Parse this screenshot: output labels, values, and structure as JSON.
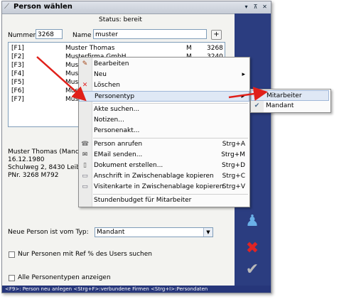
{
  "window": {
    "title": "Person wählen",
    "status": "Status: bereit",
    "title_buttons": [
      "▾",
      "⊼",
      "✕"
    ]
  },
  "search": {
    "nummer_label": "Nummer",
    "nummer_value": "3268",
    "name_label": "Name",
    "name_value": "muster",
    "plus_label": "+"
  },
  "list": {
    "rows": [
      {
        "key": "[F1]",
        "name": "Muster Thomas",
        "type": "M",
        "num": "3268"
      },
      {
        "key": "[F2]",
        "name": "Musterfirma GmbH",
        "type": "M",
        "num": "3240"
      },
      {
        "key": "[F3]",
        "name": "Mus",
        "type": "",
        "num": ""
      },
      {
        "key": "[F4]",
        "name": "Mus",
        "type": "",
        "num": ""
      },
      {
        "key": "[F5]",
        "name": "Mus",
        "type": "",
        "num": ""
      },
      {
        "key": "[F6]",
        "name": "Mus",
        "type": "",
        "num": ""
      },
      {
        "key": "[F7]",
        "name": "Mus",
        "type": "",
        "num": ""
      }
    ]
  },
  "details": {
    "line1": "Muster Thomas (Manc",
    "line2": "16.12.1980",
    "line3": "Schulweg 2, 8430 Leib",
    "line4": "PNr. 3268 M792"
  },
  "form": {
    "type_label": "Neue Person ist vom Typ:",
    "type_value": "Mandant",
    "only_ref_label": "Nur Personen mit Ref % des Users suchen",
    "all_types_label": "Alle Personentypen anzeigen"
  },
  "status_bar": "<F9>: Person neu anlegen <Strg+F>:verbundene Firmen <Strg+I>:Persondaten",
  "context_menu": {
    "items": [
      {
        "label": "Bearbeiten",
        "shortcut": "",
        "icon": "edit-icon"
      },
      {
        "label": "Neu",
        "shortcut": "",
        "icon": ""
      },
      {
        "label": "Löschen",
        "shortcut": "",
        "icon": "delete-icon"
      },
      {
        "label": "Personentyp",
        "shortcut": "",
        "icon": ""
      },
      {
        "label": "Akte suchen...",
        "shortcut": "",
        "icon": ""
      },
      {
        "label": "Notizen...",
        "shortcut": "",
        "icon": ""
      },
      {
        "label": "Personenakt...",
        "shortcut": "",
        "icon": ""
      },
      {
        "label": "Person anrufen",
        "shortcut": "Strg+A",
        "icon": "phone-icon"
      },
      {
        "label": "EMail senden...",
        "shortcut": "Strg+M",
        "icon": "mail-icon"
      },
      {
        "label": "Dokument erstellen...",
        "shortcut": "Strg+D",
        "icon": "document-icon"
      },
      {
        "label": "Anschrift in Zwischenablage kopieren",
        "shortcut": "Strg+C",
        "icon": "card-icon"
      },
      {
        "label": "Visitenkarte in Zwischenablage kopieren",
        "shortcut": "Strg+V",
        "icon": "card-icon"
      },
      {
        "label": "Stundenbudget für Mitarbeiter",
        "shortcut": "",
        "icon": ""
      }
    ],
    "submenu_arrow": "▸"
  },
  "submenu": {
    "items": [
      "Mitarbeiter",
      "Mandant"
    ]
  },
  "colors": {
    "accent_bar": "#2b3d80",
    "arrow": "#e0201a",
    "status_bar": "#26367a"
  }
}
